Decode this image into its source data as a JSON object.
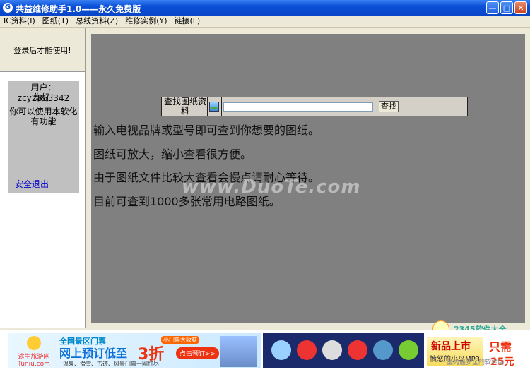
{
  "window": {
    "title": "共益维修助手1.0——永久免费版",
    "app_icon_glyph": "G",
    "minimize": "—",
    "maximize": "□",
    "close": "✕"
  },
  "menu": [
    {
      "label": "IC资料(I)"
    },
    {
      "label": "图纸(T)"
    },
    {
      "label": "总线资料(Z)"
    },
    {
      "label": "维修实例(Y)"
    },
    {
      "label": "链接(L)"
    }
  ],
  "sidebar": {
    "login_notice": "登录后才能使用!",
    "user_line1": "用户：zcy2855342",
    "user_line2": "你好!",
    "user_line3": "你可以使用本软化",
    "user_line4": "有功能",
    "logout": "安全退出"
  },
  "search": {
    "label": "查找图纸资料",
    "input_value": "",
    "button": "查找"
  },
  "info_lines": [
    "输入电视品牌或型号即可查到你想要的图纸。",
    "图纸可放大，缩小查看很方便。",
    "由于图纸文件比较大查看会慢点请耐心等待。",
    "目前可查到1000多张常用电路图纸。"
  ],
  "watermark": "www.DuoTe.com",
  "banner": {
    "ad1_brand": "途牛旅游网 Tuniu.com",
    "ad1_t1": "全国景区门票",
    "ad1_t2": "网上预订低至",
    "ad1_t3": "3折",
    "ad1_tag": "小门票大收获",
    "ad1_btn": "点击预订>>",
    "ad1_t4": "温泉、滑雪、古迹、风景门票一网打尽",
    "ad3_a": "新品上市",
    "ad3_b": "愤怒的小鸟MP3",
    "ad3_only": "只需",
    "ad3_price": "25元",
    "logo_text": "2345软件大全",
    "logo_sub": "国内最安全的软件站"
  },
  "colors": {
    "title_bar": "#0a50d8",
    "main_bg": "#808080",
    "link": "#0000cc"
  }
}
